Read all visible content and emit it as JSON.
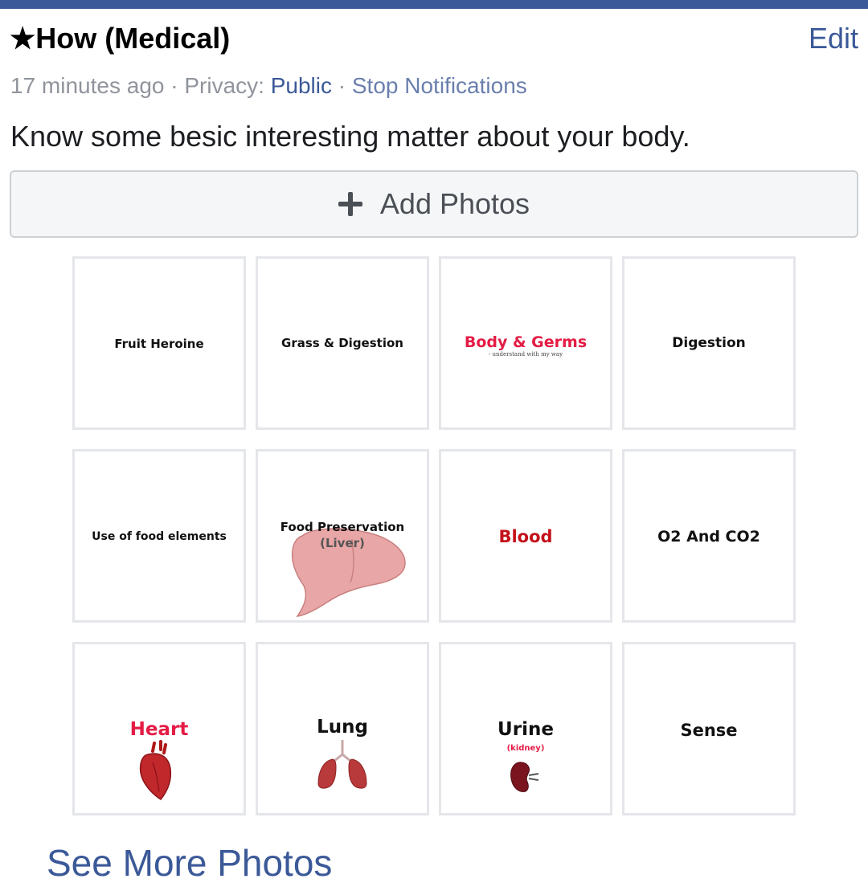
{
  "header": {
    "title": "★How (Medical)",
    "edit_label": "Edit"
  },
  "meta": {
    "time": "17 minutes ago",
    "sep1": " · ",
    "privacy_label": "Privacy: ",
    "privacy_value": "Public",
    "sep2": " · ",
    "stop_notifications": "Stop Notifications"
  },
  "description": "Know some besic interesting matter about your body.",
  "add_photos": {
    "label": "Add Photos",
    "icon": "plus-icon"
  },
  "photos": [
    {
      "title": "Fruit Heroine",
      "color": "#111111"
    },
    {
      "title": "Grass & Digestion",
      "color": "#111111"
    },
    {
      "title": "Body & Germs",
      "subtitle": "- understand with my way",
      "color": "#e41c45"
    },
    {
      "title": "Digestion",
      "color": "#111111"
    },
    {
      "title": "Use of food elements",
      "color": "#111111"
    },
    {
      "title": "Food Preservation",
      "subtitle": "(Liver)",
      "color": "#111111",
      "icon": "liver-icon"
    },
    {
      "title": "Blood",
      "color": "#c4121a"
    },
    {
      "title": "O2 And CO2",
      "color": "#111111"
    },
    {
      "title": "Heart",
      "color": "#e41c45",
      "icon": "heart-organ-icon"
    },
    {
      "title": "Lung",
      "color": "#111111",
      "icon": "lungs-icon"
    },
    {
      "title": "Urine",
      "subtitle": "(kidney)",
      "color": "#111111",
      "icon": "kidney-icon"
    },
    {
      "title": "Sense",
      "color": "#111111"
    }
  ],
  "see_more_label": "See More Photos",
  "colors": {
    "brand": "#3b5998",
    "meta_gray": "#90949c",
    "accent_red": "#e41c45"
  }
}
